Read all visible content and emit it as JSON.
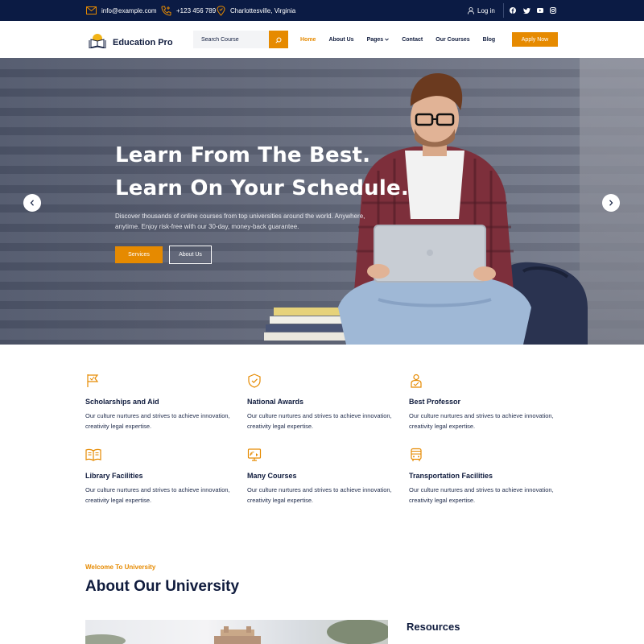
{
  "topbar": {
    "email": "info@example.com",
    "phone": "+123 456 789",
    "location": "Charlottesville, Virginia",
    "login": "Log in",
    "social_icons": [
      "facebook-icon",
      "twitter-icon",
      "youtube-icon",
      "instagram-icon"
    ]
  },
  "nav": {
    "brand": "Education Pro",
    "search_placeholder": "Search Course",
    "links": [
      "Home",
      "About Us",
      "Pages",
      "Contact",
      "Our Courses",
      "Blog"
    ],
    "active_link": "Home",
    "apply_label": "Apply Now"
  },
  "hero": {
    "heading_line1": "Learn From The Best.",
    "heading_line2": "Learn On Your Schedule.",
    "description": "Discover thousands of online courses from top universities around the world. Anywhere, anytime. Enjoy risk-free with our 30-day, money-back guarantee.",
    "primary_button": "Services",
    "secondary_button": "About Us"
  },
  "features": [
    {
      "icon": "flag-icon",
      "title": "Scholarships and Aid",
      "description": "Our culture nurtures and strives to achieve innovation, creativity legal expertise."
    },
    {
      "icon": "shield-check-icon",
      "title": "National Awards",
      "description": "Our culture nurtures and strives to achieve innovation, creativity legal expertise."
    },
    {
      "icon": "professor-icon",
      "title": "Best Professor",
      "description": "Our culture nurtures and strives to achieve innovation, creativity legal expertise."
    },
    {
      "icon": "book-open-icon",
      "title": "Library Facilities",
      "description": "Our culture nurtures and strives to achieve innovation, creativity legal expertise."
    },
    {
      "icon": "online-course-icon",
      "title": "Many Courses",
      "description": "Our culture nurtures and strives to achieve innovation, creativity legal expertise."
    },
    {
      "icon": "bus-icon",
      "title": "Transportation Facilities",
      "description": "Our culture nurtures and strives to achieve innovation, creativity legal expertise."
    }
  ],
  "about": {
    "eyebrow": "Welcome To University",
    "title": "About Our University",
    "sidebar_heading": "Resources"
  },
  "colors": {
    "accent": "#e68a00",
    "navy": "#0b1b44",
    "text": "#0f1b3d"
  }
}
